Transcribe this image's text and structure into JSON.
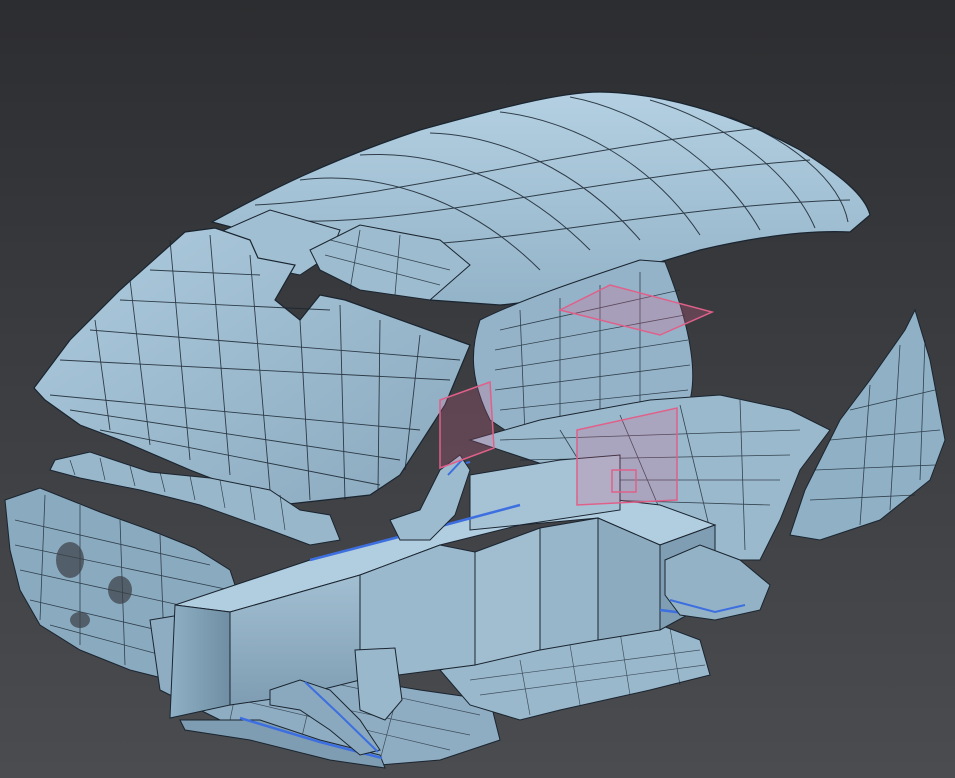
{
  "viewport": {
    "view": "3d-cad-viewport",
    "model": "car-body-interior-surface-mesh",
    "colors": {
      "background_top": "#2c2d30",
      "background_bottom": "#4a4c50",
      "surface": "#a6c4d8",
      "surface_shadow": "#87a6bb",
      "surface_dark": "#6f8ea3",
      "wire": "#1a2530",
      "edge_highlight": "#3d6fe0",
      "section_plane": "#e0608a"
    }
  }
}
